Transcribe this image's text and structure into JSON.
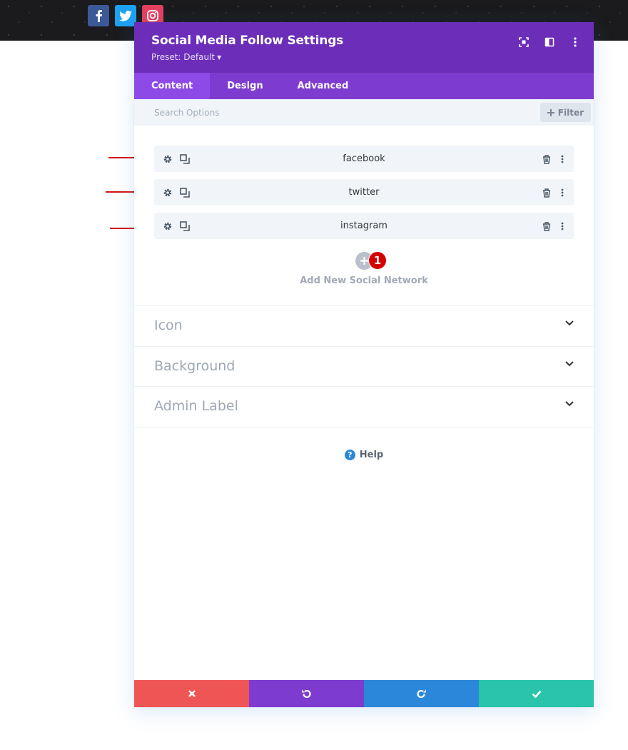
{
  "page": {
    "social_icons": [
      {
        "name": "facebook-icon",
        "color": "#3b5998"
      },
      {
        "name": "twitter-icon",
        "color": "#1da1f2"
      },
      {
        "name": "instagram-icon",
        "color": "#e4405f"
      }
    ]
  },
  "modal": {
    "title": "Social Media Follow Settings",
    "preset": "Preset: Default",
    "header_icons": [
      "focus-mode-icon",
      "split-view-icon",
      "more-options-icon"
    ],
    "tabs": [
      {
        "label": "Content",
        "active": true
      },
      {
        "label": "Design",
        "active": false
      },
      {
        "label": "Advanced",
        "active": false
      }
    ],
    "search": {
      "placeholder": "Search Options",
      "filter_label": "Filter"
    },
    "networks": [
      {
        "label": "facebook"
      },
      {
        "label": "twitter"
      },
      {
        "label": "instagram"
      }
    ],
    "add_new": {
      "label": "Add New Social Network",
      "badge": "1"
    },
    "sections": [
      {
        "label": "Icon"
      },
      {
        "label": "Background"
      },
      {
        "label": "Admin Label"
      }
    ],
    "help_label": "Help",
    "footer": {
      "buttons": [
        {
          "name": "cancel-button",
          "icon": "close-icon",
          "color": "#ef5555"
        },
        {
          "name": "undo-button",
          "icon": "undo-icon",
          "color": "#7e3bd0"
        },
        {
          "name": "redo-button",
          "icon": "redo-icon",
          "color": "#2b87da"
        },
        {
          "name": "save-button",
          "icon": "check-icon",
          "color": "#29c4a9"
        }
      ]
    }
  },
  "colors": {
    "header_bg": "#6c2eb9",
    "tabs_bg": "#7e3bd0",
    "active_tab_bg": "#8e4ae6",
    "annotation_red": "#d21414"
  }
}
